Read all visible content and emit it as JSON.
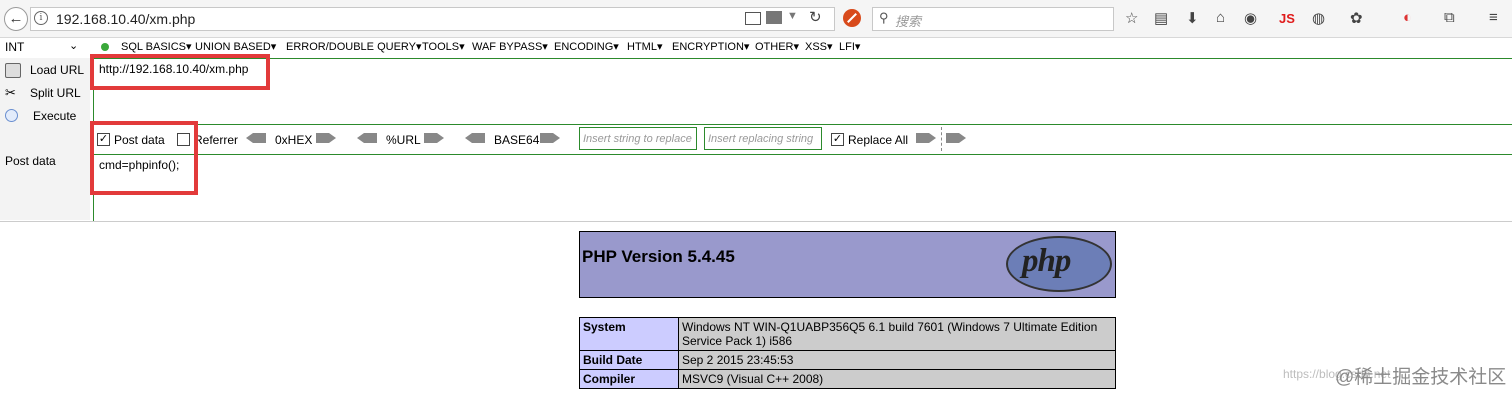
{
  "browser": {
    "url": "192.168.10.40/xm.php",
    "search_placeholder": "搜索",
    "js_badge": "JS"
  },
  "hackbar": {
    "select_value": "INT",
    "menu": [
      "SQL BASICS▾",
      "UNION BASED▾",
      "ERROR/DOUBLE QUERY▾",
      "TOOLS▾",
      "WAF BYPASS▾",
      "ENCODING▾",
      "HTML▾",
      "ENCRYPTION▾",
      "OTHER▾",
      "XSS▾",
      "LFI▾"
    ],
    "load_url": "Load URL",
    "split_url": "Split URL",
    "execute": "Execute",
    "url_value": "http://192.168.10.40/xm.php",
    "post_data_checkbox": "Post data",
    "post_data_checked": true,
    "referrer_checkbox": "Referrer",
    "referrer_checked": false,
    "hex_label": "0xHEX",
    "url_label": "%URL",
    "base64_label": "BASE64",
    "replace_placeholder": "Insert string to replace",
    "replacing_placeholder": "Insert replacing string",
    "replace_all": "Replace All",
    "replace_all_checked": true,
    "post_label": "Post data",
    "post_value": "cmd=phpinfo();"
  },
  "phpinfo": {
    "version": "PHP Version 5.4.45",
    "logo_text": "php",
    "rows": [
      {
        "key": "System",
        "value": "Windows NT WIN-Q1UABP356Q5 6.1 build 7601 (Windows 7 Ultimate Edition Service Pack 1) i586"
      },
      {
        "key": "Build Date",
        "value": "Sep 2 2015 23:45:53"
      },
      {
        "key": "Compiler",
        "value": "MSVC9 (Visual C++ 2008)"
      }
    ]
  },
  "watermark": {
    "url_fragment": "https://blog.csdn.net",
    "text": "@稀土掘金技术社区"
  }
}
